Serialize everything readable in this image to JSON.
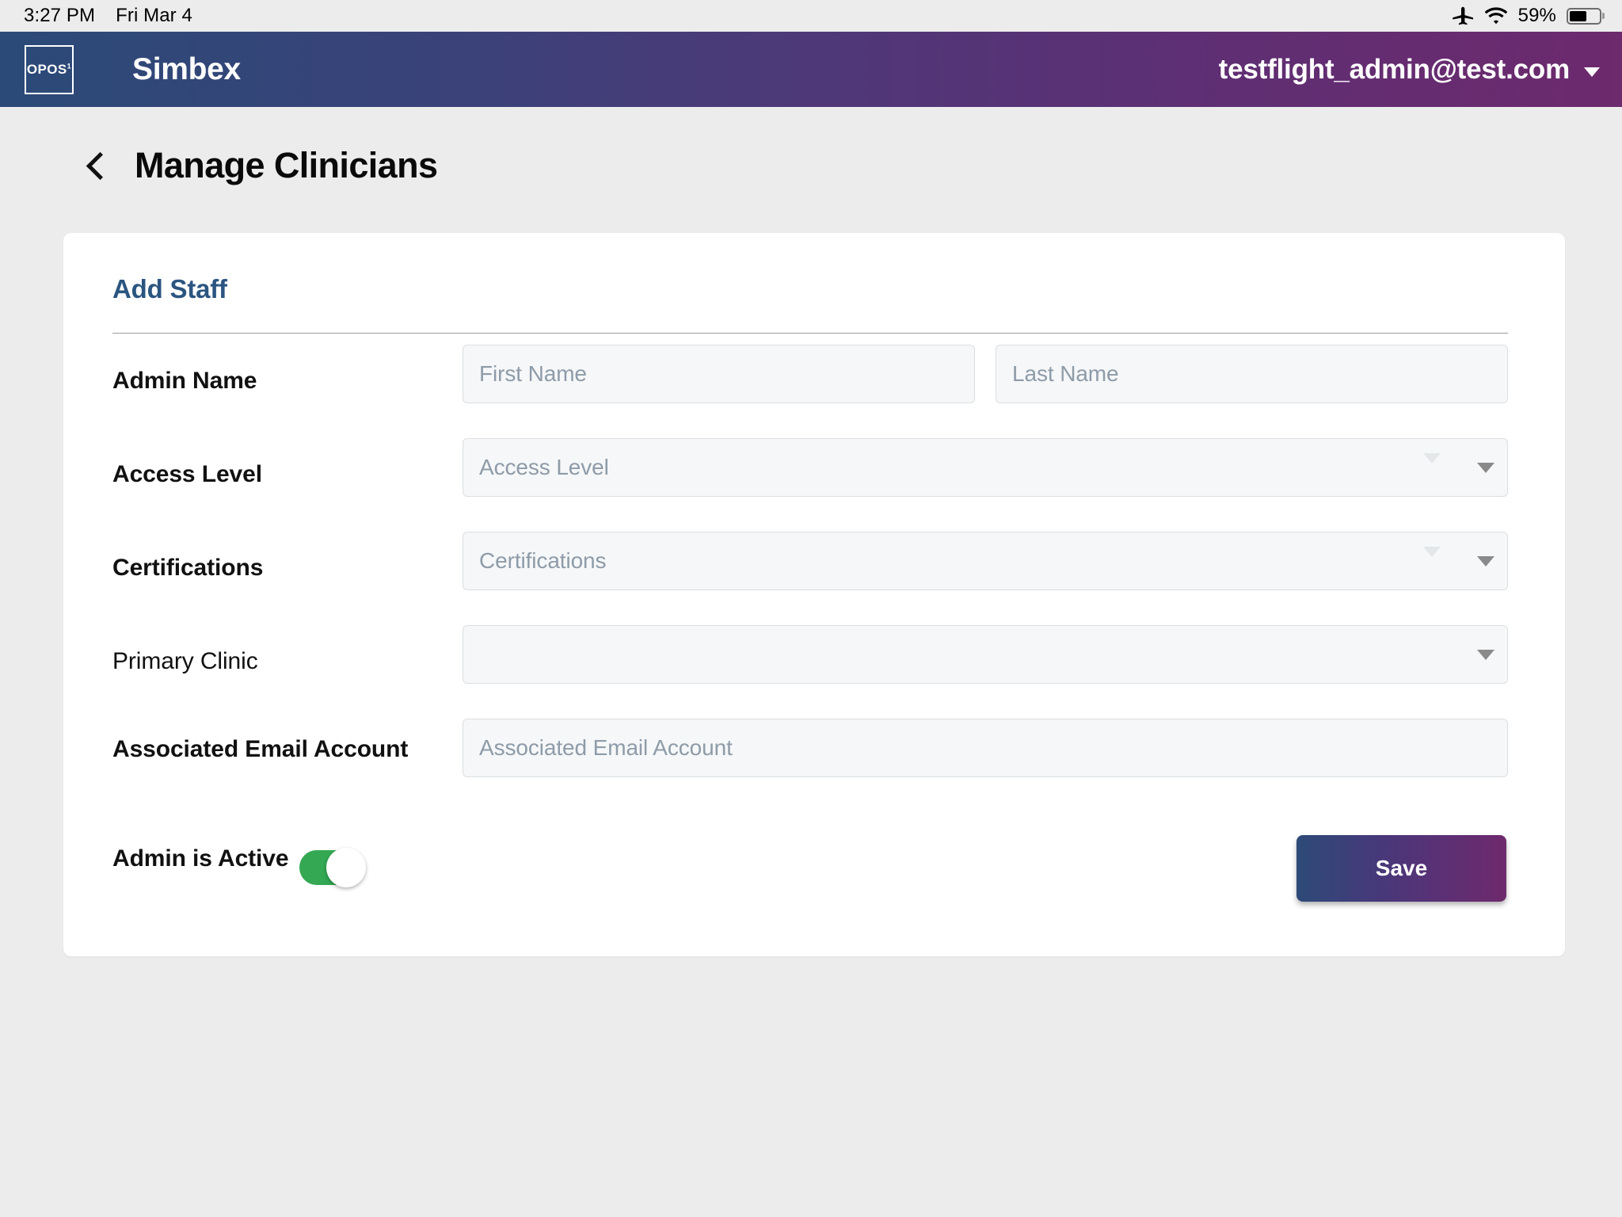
{
  "status_bar": {
    "time": "3:27 PM",
    "date": "Fri Mar 4",
    "battery_percent": "59%",
    "icons": [
      "airplane-mode-icon",
      "wifi-icon",
      "battery-icon"
    ]
  },
  "app_bar": {
    "logo_text": "OPOS",
    "logo_superscript": "1",
    "brand": "Simbex",
    "account_email": "testflight_admin@test.com",
    "account_caret": "chevron-down-icon",
    "gradient_from": "#2b4a78",
    "gradient_to": "#6d2a6d"
  },
  "page": {
    "back_label": "back-chevron",
    "title": "Manage Clinicians"
  },
  "card": {
    "title": "Add Staff",
    "title_color": "#2b5580"
  },
  "form": {
    "rows": [
      {
        "label": "Admin Name",
        "bold": true,
        "fields": [
          {
            "type": "text",
            "placeholder": "First Name",
            "value": ""
          },
          {
            "type": "text",
            "placeholder": "Last Name",
            "value": ""
          }
        ]
      },
      {
        "label": "Access Level",
        "bold": true,
        "fields": [
          {
            "type": "select",
            "placeholder": "Access Level",
            "value": ""
          }
        ]
      },
      {
        "label": "Certifications",
        "bold": true,
        "fields": [
          {
            "type": "select",
            "placeholder": "Certifications",
            "value": ""
          }
        ]
      },
      {
        "label": "Primary Clinic",
        "bold": false,
        "fields": [
          {
            "type": "select",
            "placeholder": "",
            "value": ""
          }
        ]
      },
      {
        "label": "Associated Email Account",
        "bold": true,
        "fields": [
          {
            "type": "text",
            "placeholder": "Associated Email Account",
            "value": ""
          }
        ]
      }
    ],
    "toggle_row": {
      "label": "Admin is Active",
      "toggle_on": true,
      "toggle_on_color": "#34a853",
      "save_label": "Save"
    }
  }
}
